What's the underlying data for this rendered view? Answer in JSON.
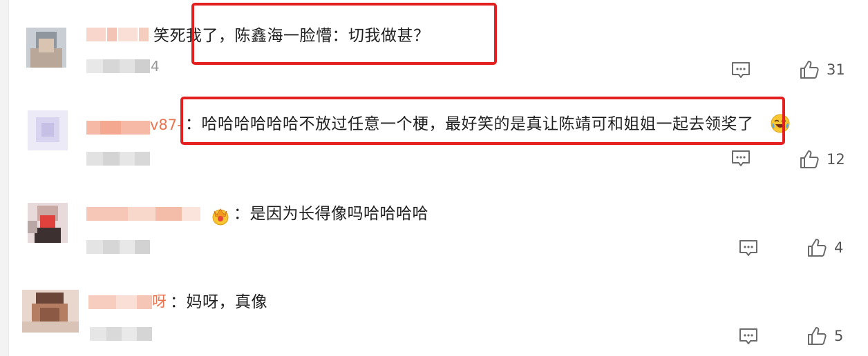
{
  "comments": [
    {
      "text": "笑死我了，陈鑫海一脸懵：切我做甚？",
      "name_suffix": "",
      "meta_suffix": "4",
      "like_count": "31"
    },
    {
      "text": "：哈哈哈哈哈哈不放过任意一个梗，最好笑的是真让陈靖可和姐姐一起去领奖了",
      "name_suffix": "v87-",
      "meta_suffix": "",
      "like_count": "12"
    },
    {
      "text": "：是因为长得像吗哈哈哈哈",
      "name_suffix": "",
      "meta_suffix": "",
      "like_count": "4"
    },
    {
      "text": "：妈呀，真像",
      "name_suffix": "呀",
      "meta_suffix": "",
      "like_count": "5"
    }
  ],
  "icons": {
    "reply": "comment-bubble-icon",
    "like": "thumbs-up-icon",
    "emoji_laugh": "laughing-crying-emoji-icon",
    "emoji_crown": "crown-badge-emoji-icon"
  },
  "colors": {
    "highlight": "#e41f1f",
    "username": "#eb7350",
    "count": "#555555"
  }
}
